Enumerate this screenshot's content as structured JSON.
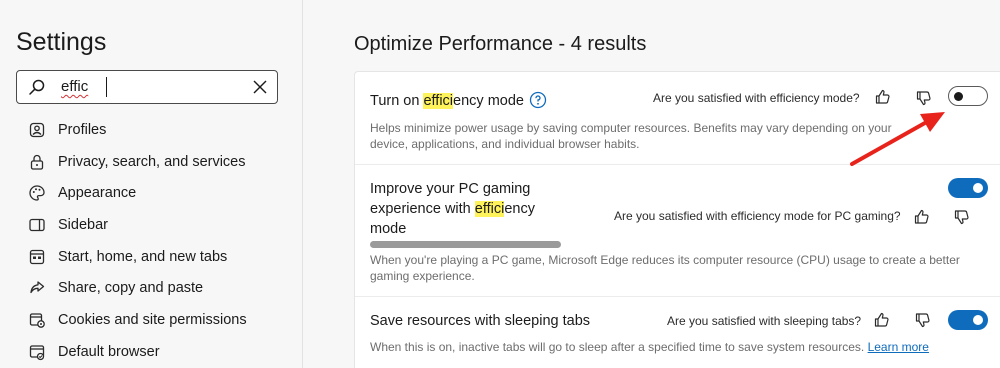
{
  "sidebar": {
    "title": "Settings",
    "search": {
      "value": "effic"
    },
    "items": [
      {
        "label": "Profiles",
        "icon": "profile-icon"
      },
      {
        "label": "Privacy, search, and services",
        "icon": "lock-icon"
      },
      {
        "label": "Appearance",
        "icon": "palette-icon"
      },
      {
        "label": "Sidebar",
        "icon": "sidebar-icon"
      },
      {
        "label": "Start, home, and new tabs",
        "icon": "home-tabs-icon"
      },
      {
        "label": "Share, copy and paste",
        "icon": "share-icon"
      },
      {
        "label": "Cookies and site permissions",
        "icon": "cookies-icon"
      },
      {
        "label": "Default browser",
        "icon": "browser-icon"
      }
    ]
  },
  "main": {
    "title": "Optimize Performance - 4 results",
    "settings": [
      {
        "title_pre": "Turn on ",
        "title_highlight": "effici",
        "title_post": "ency mode",
        "feedback": "Are you satisfied with efficiency mode?",
        "description": "Helps minimize power usage by saving computer resources. Benefits may vary depending on your device, applications, and individual browser habits.",
        "enabled": false
      },
      {
        "title_pre": "Improve your PC gaming experience with ",
        "title_highlight": "effici",
        "title_post": "ency mode",
        "feedback": "Are you satisfied with efficiency mode for PC gaming?",
        "description": "When you're playing a PC game, Microsoft Edge reduces its computer resource (CPU) usage to create a better gaming experience.",
        "enabled": true
      },
      {
        "title": "Save resources with sleeping tabs",
        "feedback": "Are you satisfied with sleeping tabs?",
        "description": "When this is on, inactive tabs will go to sleep after a specified time to save system resources.",
        "link": "Learn more",
        "enabled": true
      }
    ]
  },
  "colors": {
    "accent": "#0f6cbd",
    "highlight": "#fff35c",
    "annotation": "#e8231c"
  }
}
